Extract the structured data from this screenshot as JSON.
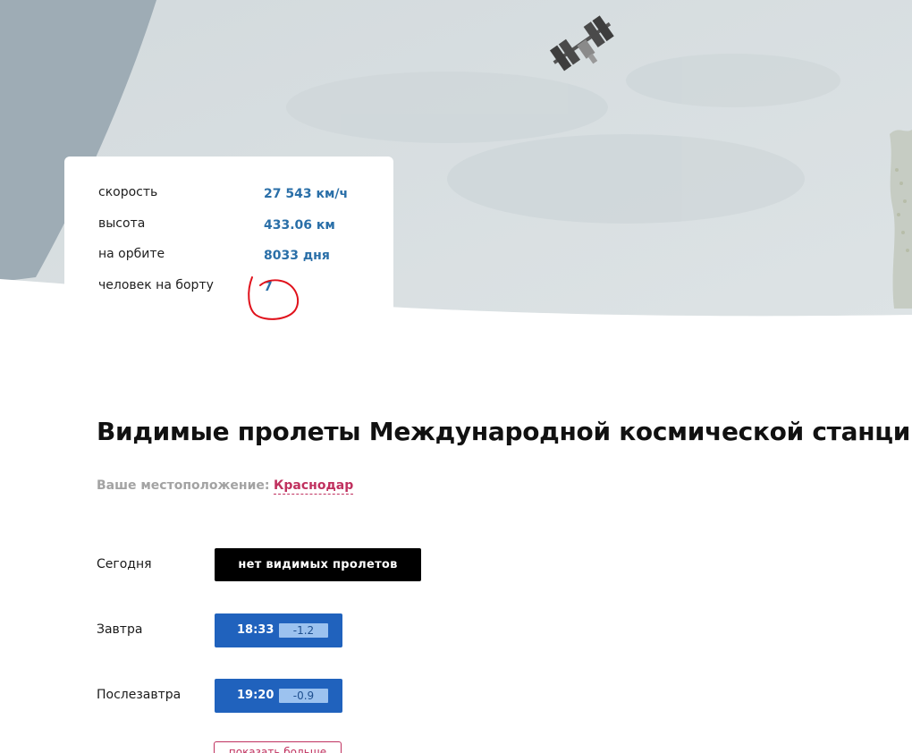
{
  "stats": [
    {
      "label": "скорость",
      "value": "27 543 км/ч"
    },
    {
      "label": "высота",
      "value": "433.06 км"
    },
    {
      "label": "на орбите",
      "value": "8033 дня"
    },
    {
      "label": "человек на борту",
      "value": "7"
    }
  ],
  "passes_section": {
    "title": "Видимые пролеты Международной космической станции",
    "location_label": "Ваше местоположение:",
    "location_city": "Краснодар"
  },
  "passes": [
    {
      "day": "Сегодня",
      "status": "нет видимых пролетов"
    },
    {
      "day": "Завтра",
      "time": "18:33",
      "magnitude": "-1.2"
    },
    {
      "day": "Послезавтра",
      "time": "19:20",
      "magnitude": "-0.9"
    }
  ],
  "more_button": {
    "label": "показать больше"
  },
  "colors": {
    "accent_blue": "#2062bd",
    "value_blue": "#2a6fa8",
    "link_red": "#c0315f",
    "annotation_red": "#e0111b"
  },
  "icons": {
    "station": "iss-icon"
  }
}
